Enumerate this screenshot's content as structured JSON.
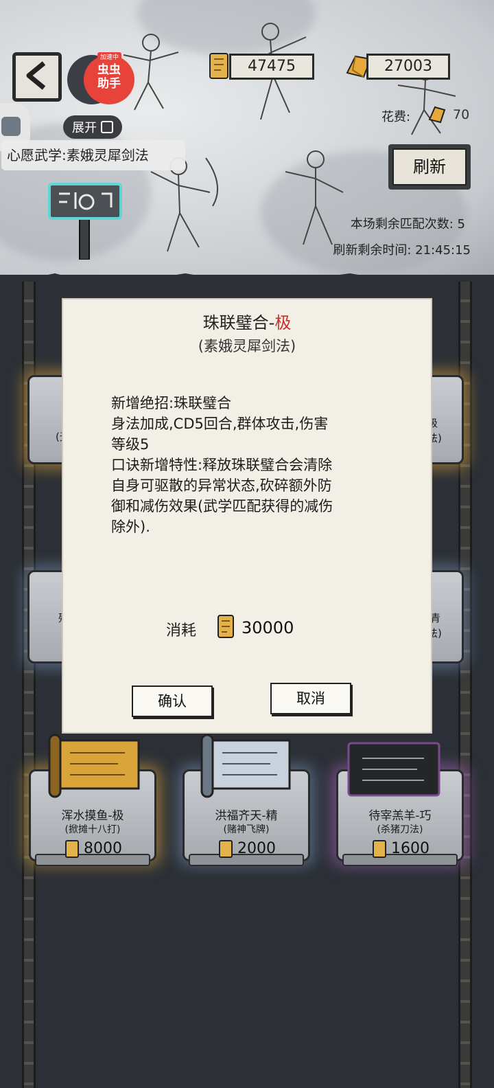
{
  "header": {
    "back_icon": "chevron-left-icon",
    "assist": {
      "tag": "加速中",
      "line1": "虫虫",
      "line2": "助手"
    },
    "expand_label": "展开",
    "wish_text": "心愿武学:素娥灵犀剑法",
    "currency_scroll": "47475",
    "currency_gold": "27003",
    "cost_label": "花费:",
    "cost_value": "70",
    "refresh_label": "刷新",
    "remaining_matches": "本场剩余匹配次数: 5",
    "refresh_timer": "刷新剩余时间:  21:45:15"
  },
  "modal": {
    "title_main": "珠联璧合-",
    "title_grade": "极",
    "subtitle": "(素娥灵犀剑法)",
    "description_lines": [
      "新增绝招:珠联璧合",
      "身法加成,CD5回合,群体攻击,伤害",
      "等级5",
      "口诀新增特性:释放珠联璧合会清除",
      "自身可驱散的异常状态,砍碎额外防",
      "御和减伤效果(武学匹配获得的减伤",
      "除外)."
    ],
    "consume_label": "消耗",
    "consume_value": "30000",
    "confirm_label": "确认",
    "cancel_label": "取消"
  },
  "shelf": {
    "row1_left_partial": "(无",
    "row1_right_partial": [
      "级",
      "法)"
    ],
    "row2_left_partial": "残",
    "row2_right_partial": [
      "青",
      "法)"
    ],
    "items": [
      {
        "name": "浑水摸鱼-极",
        "sub": "(掀摊十八打)",
        "price": "8000"
      },
      {
        "name": "洪福齐天-精",
        "sub": "(赌神飞牌)",
        "price": "2000"
      },
      {
        "name": "待宰羔羊-巧",
        "sub": "(杀猪刀法)",
        "price": "1600"
      }
    ]
  },
  "colors": {
    "grade_red": "#c8302a",
    "assist_red": "#e8433a",
    "gold_glow": "#e6aa3c",
    "purple_glow": "#be6edc"
  }
}
